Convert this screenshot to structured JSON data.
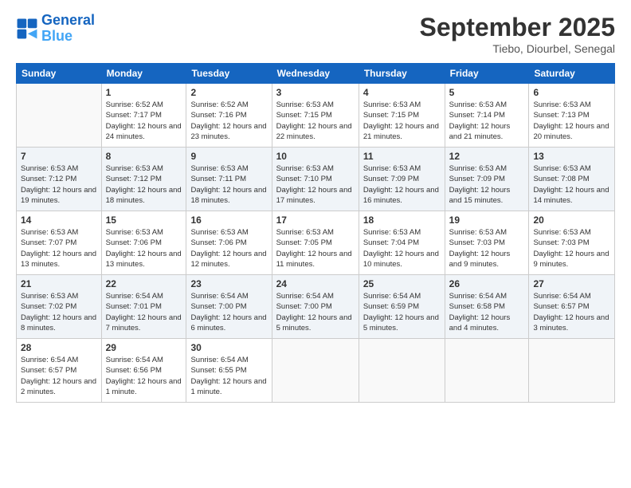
{
  "header": {
    "logo_line1": "General",
    "logo_line2": "Blue",
    "month": "September 2025",
    "location": "Tiebo, Diourbel, Senegal"
  },
  "days_of_week": [
    "Sunday",
    "Monday",
    "Tuesday",
    "Wednesday",
    "Thursday",
    "Friday",
    "Saturday"
  ],
  "weeks": [
    [
      {
        "day": null
      },
      {
        "day": 1,
        "sunrise": "6:52 AM",
        "sunset": "7:17 PM",
        "daylight": "12 hours and 24 minutes."
      },
      {
        "day": 2,
        "sunrise": "6:52 AM",
        "sunset": "7:16 PM",
        "daylight": "12 hours and 23 minutes."
      },
      {
        "day": 3,
        "sunrise": "6:53 AM",
        "sunset": "7:15 PM",
        "daylight": "12 hours and 22 minutes."
      },
      {
        "day": 4,
        "sunrise": "6:53 AM",
        "sunset": "7:15 PM",
        "daylight": "12 hours and 21 minutes."
      },
      {
        "day": 5,
        "sunrise": "6:53 AM",
        "sunset": "7:14 PM",
        "daylight": "12 hours and 21 minutes."
      },
      {
        "day": 6,
        "sunrise": "6:53 AM",
        "sunset": "7:13 PM",
        "daylight": "12 hours and 20 minutes."
      }
    ],
    [
      {
        "day": 7,
        "sunrise": "6:53 AM",
        "sunset": "7:12 PM",
        "daylight": "12 hours and 19 minutes."
      },
      {
        "day": 8,
        "sunrise": "6:53 AM",
        "sunset": "7:12 PM",
        "daylight": "12 hours and 18 minutes."
      },
      {
        "day": 9,
        "sunrise": "6:53 AM",
        "sunset": "7:11 PM",
        "daylight": "12 hours and 18 minutes."
      },
      {
        "day": 10,
        "sunrise": "6:53 AM",
        "sunset": "7:10 PM",
        "daylight": "12 hours and 17 minutes."
      },
      {
        "day": 11,
        "sunrise": "6:53 AM",
        "sunset": "7:09 PM",
        "daylight": "12 hours and 16 minutes."
      },
      {
        "day": 12,
        "sunrise": "6:53 AM",
        "sunset": "7:09 PM",
        "daylight": "12 hours and 15 minutes."
      },
      {
        "day": 13,
        "sunrise": "6:53 AM",
        "sunset": "7:08 PM",
        "daylight": "12 hours and 14 minutes."
      }
    ],
    [
      {
        "day": 14,
        "sunrise": "6:53 AM",
        "sunset": "7:07 PM",
        "daylight": "12 hours and 13 minutes."
      },
      {
        "day": 15,
        "sunrise": "6:53 AM",
        "sunset": "7:06 PM",
        "daylight": "12 hours and 13 minutes."
      },
      {
        "day": 16,
        "sunrise": "6:53 AM",
        "sunset": "7:06 PM",
        "daylight": "12 hours and 12 minutes."
      },
      {
        "day": 17,
        "sunrise": "6:53 AM",
        "sunset": "7:05 PM",
        "daylight": "12 hours and 11 minutes."
      },
      {
        "day": 18,
        "sunrise": "6:53 AM",
        "sunset": "7:04 PM",
        "daylight": "12 hours and 10 minutes."
      },
      {
        "day": 19,
        "sunrise": "6:53 AM",
        "sunset": "7:03 PM",
        "daylight": "12 hours and 9 minutes."
      },
      {
        "day": 20,
        "sunrise": "6:53 AM",
        "sunset": "7:03 PM",
        "daylight": "12 hours and 9 minutes."
      }
    ],
    [
      {
        "day": 21,
        "sunrise": "6:53 AM",
        "sunset": "7:02 PM",
        "daylight": "12 hours and 8 minutes."
      },
      {
        "day": 22,
        "sunrise": "6:54 AM",
        "sunset": "7:01 PM",
        "daylight": "12 hours and 7 minutes."
      },
      {
        "day": 23,
        "sunrise": "6:54 AM",
        "sunset": "7:00 PM",
        "daylight": "12 hours and 6 minutes."
      },
      {
        "day": 24,
        "sunrise": "6:54 AM",
        "sunset": "7:00 PM",
        "daylight": "12 hours and 5 minutes."
      },
      {
        "day": 25,
        "sunrise": "6:54 AM",
        "sunset": "6:59 PM",
        "daylight": "12 hours and 5 minutes."
      },
      {
        "day": 26,
        "sunrise": "6:54 AM",
        "sunset": "6:58 PM",
        "daylight": "12 hours and 4 minutes."
      },
      {
        "day": 27,
        "sunrise": "6:54 AM",
        "sunset": "6:57 PM",
        "daylight": "12 hours and 3 minutes."
      }
    ],
    [
      {
        "day": 28,
        "sunrise": "6:54 AM",
        "sunset": "6:57 PM",
        "daylight": "12 hours and 2 minutes."
      },
      {
        "day": 29,
        "sunrise": "6:54 AM",
        "sunset": "6:56 PM",
        "daylight": "12 hours and 1 minute."
      },
      {
        "day": 30,
        "sunrise": "6:54 AM",
        "sunset": "6:55 PM",
        "daylight": "12 hours and 1 minute."
      },
      {
        "day": null
      },
      {
        "day": null
      },
      {
        "day": null
      },
      {
        "day": null
      }
    ]
  ]
}
